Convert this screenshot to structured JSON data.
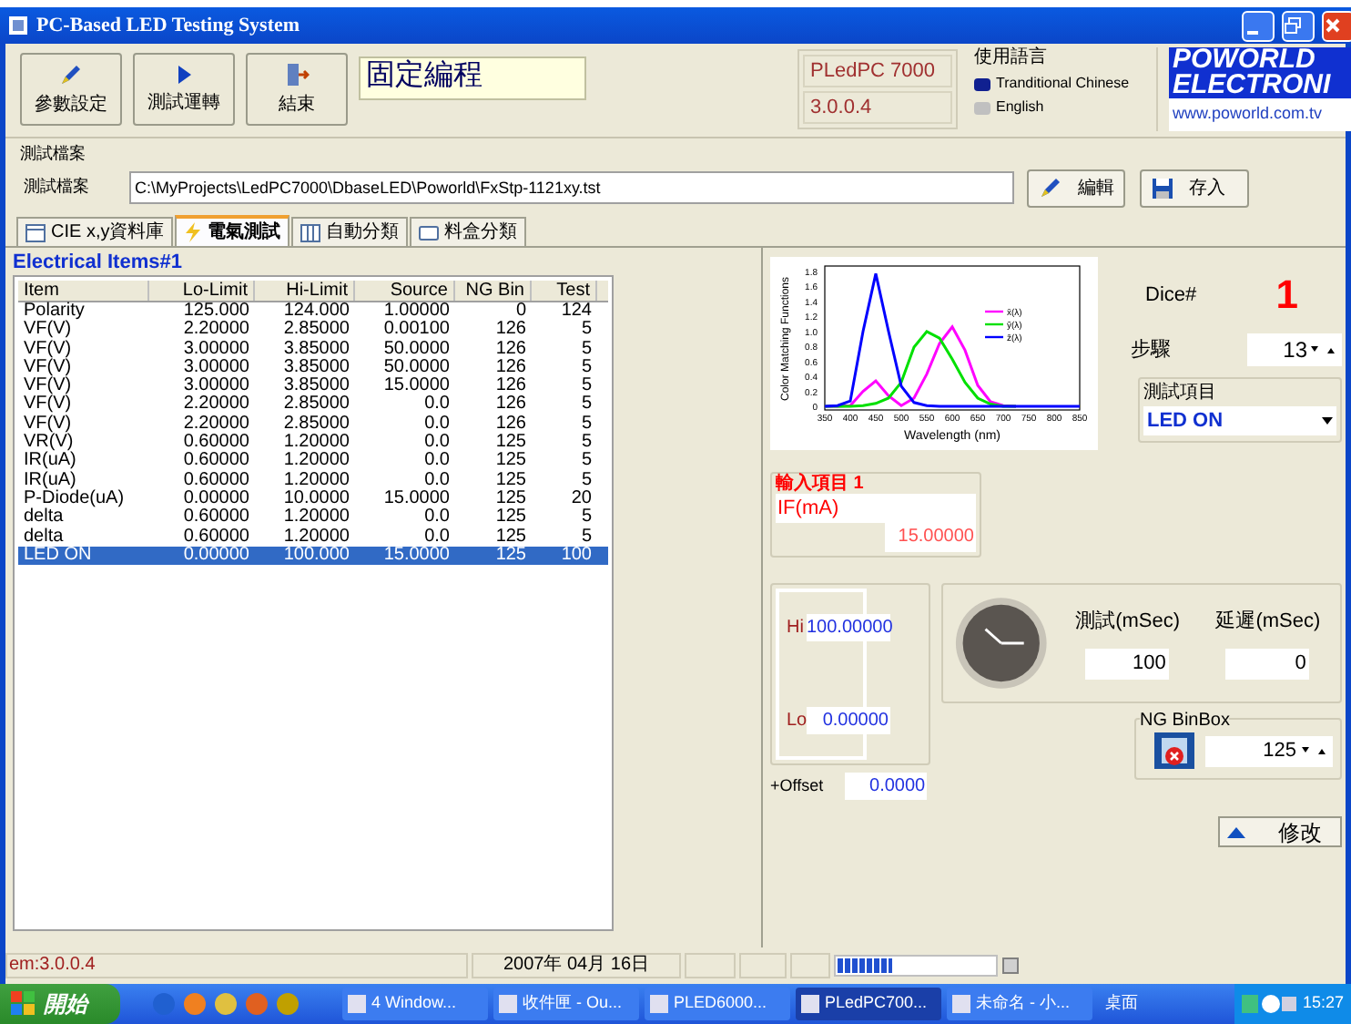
{
  "window": {
    "title": "PC-Based LED Testing System"
  },
  "toolbar": {
    "buttons": [
      {
        "label": "參數設定"
      },
      {
        "label": "測試運轉"
      },
      {
        "label": "結束"
      }
    ],
    "mode": "固定編程"
  },
  "model": {
    "name": "PLedPC 7000",
    "version": "3.0.0.4"
  },
  "language": {
    "title": "使用語言",
    "options": [
      {
        "label": "Tranditional Chinese",
        "selected": true
      },
      {
        "label": "English",
        "selected": false
      }
    ]
  },
  "logo": {
    "line_1": "POWORLD",
    "line_2": "ELECTRONI",
    "url": "www.poworld.com.tv"
  },
  "file": {
    "group_title": "測試檔案",
    "label": "測試檔案",
    "path": "C:\\MyProjects\\LedPC7000\\DbaseLED\\Poworld\\FxStp-1121xy.tst",
    "buttons": [
      {
        "label": "編輯"
      },
      {
        "label": "存入"
      }
    ]
  },
  "tabs": [
    {
      "label": "CIE x,y資料庫",
      "selected": false
    },
    {
      "label": "電氣測試",
      "selected": true
    },
    {
      "label": "自動分類",
      "selected": false
    },
    {
      "label": "料盒分類",
      "selected": false
    }
  ],
  "items": {
    "group_title": "Electrical Items#1",
    "columns": [
      "Item",
      "Lo-Limit",
      "Hi-Limit",
      "Source",
      "NG Bin",
      "Test"
    ],
    "rows": [
      {
        "cells": [
          "Polarity",
          "125.000",
          "124.000",
          "1.00000",
          "0",
          "124"
        ],
        "selected": false
      },
      {
        "cells": [
          "VF(V)",
          "2.20000",
          "2.85000",
          "0.00100",
          "126",
          "5"
        ],
        "selected": false
      },
      {
        "cells": [
          "VF(V)",
          "3.00000",
          "3.85000",
          "50.0000",
          "126",
          "5"
        ],
        "selected": false
      },
      {
        "cells": [
          "VF(V)",
          "3.00000",
          "3.85000",
          "50.0000",
          "126",
          "5"
        ],
        "selected": false
      },
      {
        "cells": [
          "VF(V)",
          "3.00000",
          "3.85000",
          "15.0000",
          "126",
          "5"
        ],
        "selected": false
      },
      {
        "cells": [
          "VF(V)",
          "2.20000",
          "2.85000",
          "0.0",
          "126",
          "5"
        ],
        "selected": false
      },
      {
        "cells": [
          "VF(V)",
          "2.20000",
          "2.85000",
          "0.0",
          "126",
          "5"
        ],
        "selected": false
      },
      {
        "cells": [
          "VR(V)",
          "0.60000",
          "1.20000",
          "0.0",
          "125",
          "5"
        ],
        "selected": false
      },
      {
        "cells": [
          "IR(uA)",
          "0.60000",
          "1.20000",
          "0.0",
          "125",
          "5"
        ],
        "selected": false
      },
      {
        "cells": [
          "IR(uA)",
          "0.60000",
          "1.20000",
          "0.0",
          "125",
          "5"
        ],
        "selected": false
      },
      {
        "cells": [
          "P-Diode(uA)",
          "0.00000",
          "10.0000",
          "15.0000",
          "125",
          "20"
        ],
        "selected": false
      },
      {
        "cells": [
          "delta",
          "0.60000",
          "1.20000",
          "0.0",
          "125",
          "5"
        ],
        "selected": false
      },
      {
        "cells": [
          "delta",
          "0.60000",
          "1.20000",
          "0.0",
          "125",
          "5"
        ],
        "selected": false
      },
      {
        "cells": [
          "LED ON",
          "0.00000",
          "100.000",
          "15.0000",
          "125",
          "100"
        ],
        "selected": true
      }
    ]
  },
  "chart_data": {
    "type": "line",
    "xlabel": "Wavelength (nm)",
    "ylabel": "Color Matching Functions",
    "x": [
      350,
      375,
      400,
      425,
      450,
      475,
      500,
      525,
      550,
      575,
      600,
      625,
      650,
      675,
      700,
      725,
      750,
      775,
      800,
      825,
      850
    ],
    "xticks": [
      350,
      400,
      450,
      500,
      550,
      600,
      650,
      700,
      750,
      800,
      850
    ],
    "yticks": [
      {
        "value": 0,
        "label": "0"
      },
      0.2,
      0.4,
      0.6,
      0.8,
      {
        "value": 1,
        "label": "1.0"
      },
      1.2,
      1.4,
      1.6,
      1.8
    ],
    "xlim": [
      350,
      850
    ],
    "ylim": [
      0,
      1.8
    ],
    "legend": true,
    "series": [
      {
        "name": "x̄(λ)",
        "color": "#ff00ff",
        "values": [
          0,
          0,
          0.01,
          0.2,
          0.34,
          0.14,
          0.01,
          0.11,
          0.43,
          0.84,
          1.06,
          0.75,
          0.28,
          0.06,
          0.01,
          0,
          null,
          null,
          null,
          null,
          null
        ]
      },
      {
        "name": "ȳ(λ)",
        "color": "#00e000",
        "values": [
          0,
          0,
          0,
          0.01,
          0.04,
          0.11,
          0.32,
          0.79,
          1.0,
          0.91,
          0.63,
          0.32,
          0.11,
          0.03,
          0,
          0,
          null,
          null,
          null,
          null,
          null
        ]
      },
      {
        "name": "z̄(λ)",
        "color": "#0000ff",
        "values": [
          0,
          0.01,
          0.07,
          1.0,
          1.77,
          1.0,
          0.27,
          0.05,
          0.01,
          0,
          0,
          0,
          0,
          0,
          0,
          0,
          0,
          0,
          0,
          0,
          0
        ]
      }
    ]
  },
  "dice": {
    "label": "Dice#",
    "value": "1"
  },
  "step": {
    "label": "步驟",
    "value": "13"
  },
  "test_item": {
    "title": "測試項目",
    "value": "LED ON"
  },
  "input_1": {
    "title": "輸入項目 1",
    "name": "IF(mA)",
    "value": "15.00000"
  },
  "limits": {
    "hi_label": "Hi",
    "hi": "100.00000",
    "lo_label": "Lo",
    "lo": "0.00000"
  },
  "offset": {
    "label": "+Offset",
    "value": "0.0000"
  },
  "timing": {
    "test_label": "測試(mSec)",
    "test": "100",
    "delay_label": "延遲(mSec)",
    "delay": "0"
  },
  "ng_binbox": {
    "title": "NG BinBox",
    "value": "125"
  },
  "modify_button": "修改",
  "status_bar": {
    "cells": [
      "em:3.0.0.4",
      "2007年 04月 16日"
    ],
    "level": 0.35
  },
  "taskbar": {
    "start": "開始",
    "tasks": [
      {
        "label": "4 Window...",
        "active": false
      },
      {
        "label": "收件匣 - Ou...",
        "active": false
      },
      {
        "label": "PLED6000...",
        "active": false
      },
      {
        "label": "PLedPC700...",
        "active": true
      },
      {
        "label": "未命名 - 小...",
        "active": false
      }
    ],
    "desktop": "桌面",
    "clock": "15:27"
  }
}
